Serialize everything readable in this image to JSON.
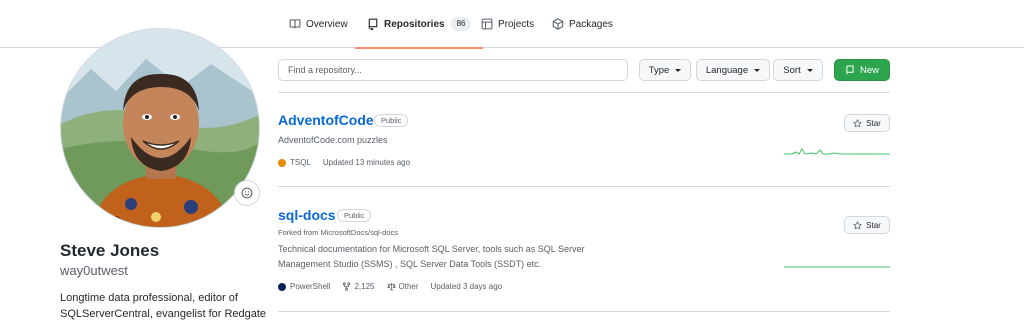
{
  "nav": {
    "tabs": [
      {
        "label": "Overview",
        "icon": "book-icon"
      },
      {
        "label": "Repositories",
        "icon": "repo-icon",
        "count": "86",
        "active": true
      },
      {
        "label": "Projects",
        "icon": "table-icon"
      },
      {
        "label": "Packages",
        "icon": "package-icon"
      }
    ]
  },
  "profile": {
    "name": "Steve Jones",
    "login": "way0utwest",
    "bio": "Longtime data professional, editor of SQLServerCentral, evangelist for Redgate"
  },
  "filters": {
    "search_placeholder": "Find a repository...",
    "type_label": "Type",
    "language_label": "Language",
    "sort_label": "Sort",
    "new_label": "New"
  },
  "repos": [
    {
      "name": "AdventofCode",
      "visibility": "Public",
      "description": "AdventofCode.com puzzles",
      "language": "TSQL",
      "language_color": "#e38c00",
      "updated": "Updated 13 minutes ago",
      "star_label": "Star"
    },
    {
      "name": "sql-docs",
      "visibility": "Public",
      "forked_from": "Forked from MicrosoftDocs/sql-docs",
      "description_line1": "Technical documentation for Microsoft SQL Server, tools such as SQL Server",
      "description_line2": "Management Studio (SSMS) , SQL Server Data Tools (SSDT) etc.",
      "language": "PowerShell",
      "language_color": "#012456",
      "forks": "2,125",
      "license": "Other",
      "updated": "Updated 3 days ago",
      "star_label": "Star"
    }
  ],
  "colors": {
    "accent": "#0969da",
    "new_button": "#2da44e",
    "active_tab_underline": "#fd8c73",
    "sparkline": "#40c463"
  }
}
